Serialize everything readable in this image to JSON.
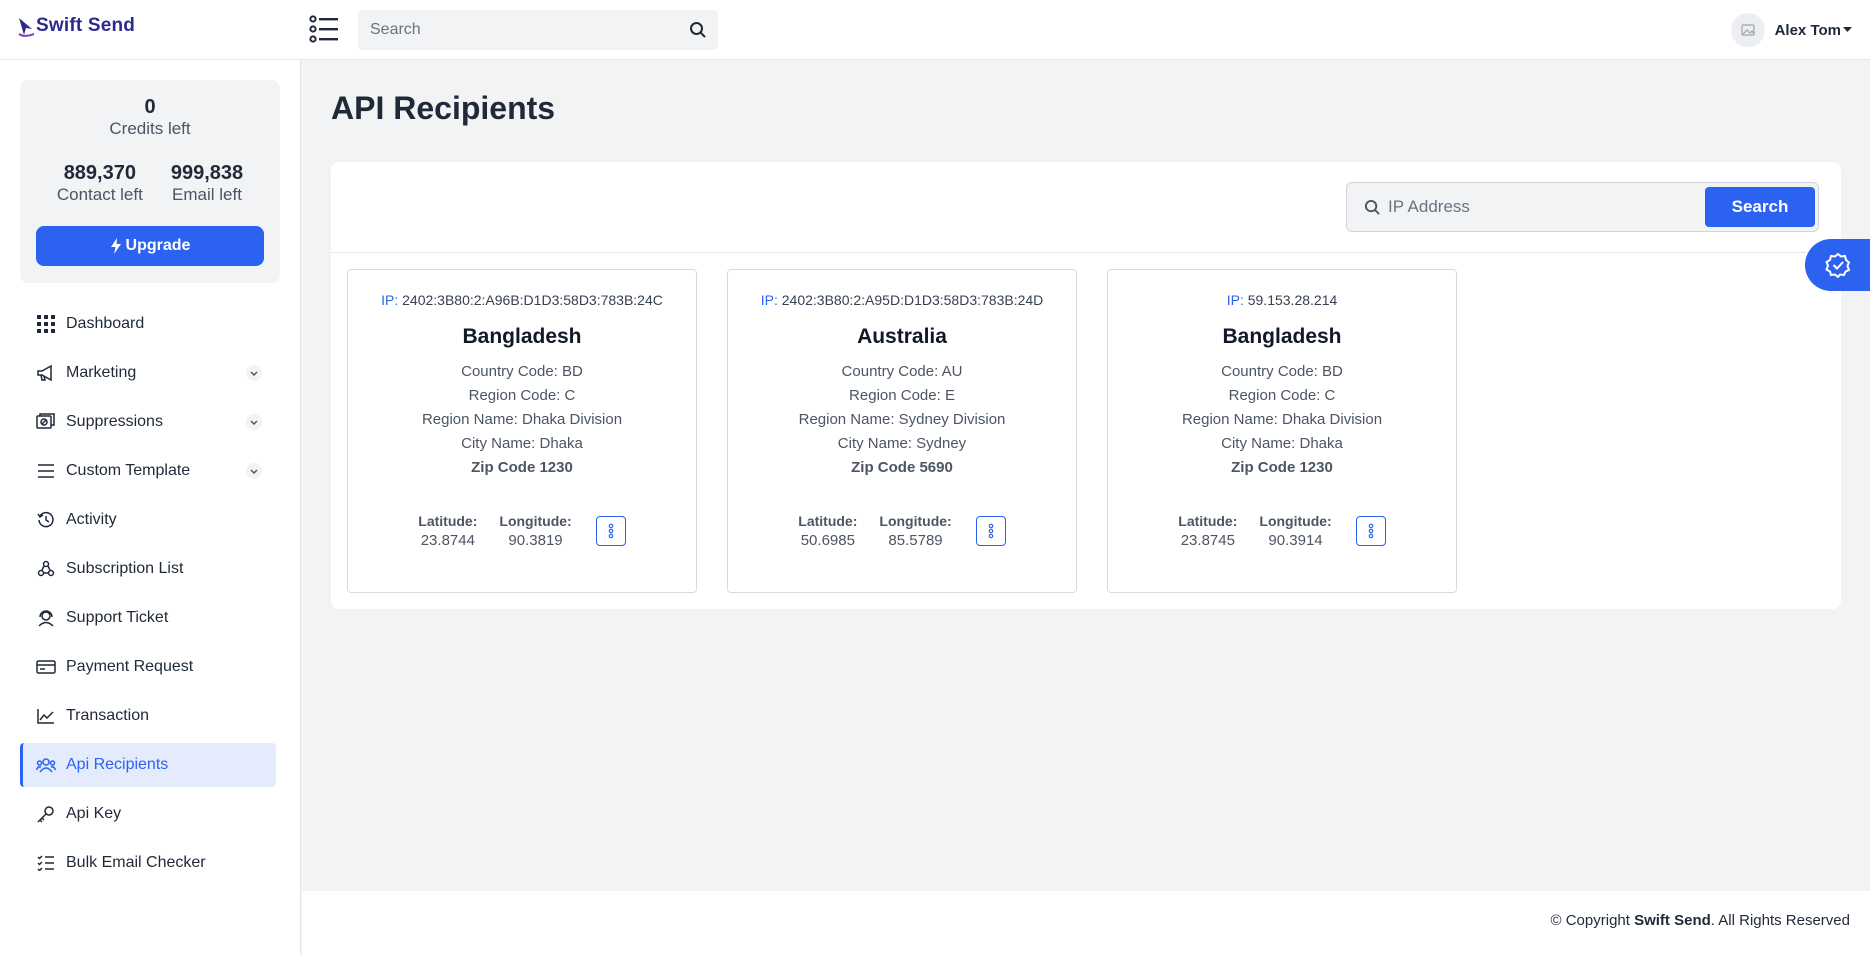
{
  "app": {
    "name": "Swift Send"
  },
  "header": {
    "search_placeholder": "Search",
    "user_name": "Alex Tom"
  },
  "credits": {
    "credits_value": "0",
    "credits_label": "Credits left",
    "contact_value": "889,370",
    "contact_label": "Contact left",
    "email_value": "999,838",
    "email_label": "Email left",
    "upgrade_label": "Upgrade"
  },
  "sidebar": {
    "items": [
      {
        "label": "Dashboard",
        "icon": "grid-icon"
      },
      {
        "label": "Marketing",
        "icon": "megaphone-icon",
        "expandable": true
      },
      {
        "label": "Suppressions",
        "icon": "suppression-icon",
        "expandable": true
      },
      {
        "label": "Custom Template",
        "icon": "list-icon",
        "expandable": true
      },
      {
        "label": "Activity",
        "icon": "history-icon"
      },
      {
        "label": "Subscription List",
        "icon": "subscription-icon"
      },
      {
        "label": "Support Ticket",
        "icon": "support-icon"
      },
      {
        "label": "Payment Request",
        "icon": "payment-icon"
      },
      {
        "label": "Transaction",
        "icon": "chart-icon"
      },
      {
        "label": "Api Recipients",
        "icon": "users-icon",
        "active": true
      },
      {
        "label": "Api Key",
        "icon": "key-icon"
      },
      {
        "label": "Bulk Email Checker",
        "icon": "checklist-icon"
      }
    ]
  },
  "main": {
    "title": "API Recipients",
    "ip_search_placeholder": "IP Address",
    "search_button": "Search",
    "ip_label": "IP:",
    "latitude_label": "Latitude:",
    "longitude_label": "Longitude:",
    "cards": [
      {
        "ip": "2402:3B80:2:A96B:D1D3:58D3:783B:24C",
        "country": "Bangladesh",
        "country_code": "Country Code: BD",
        "region_code": "Region Code: C",
        "region_name": "Region Name: Dhaka Division",
        "city_name": "City Name: Dhaka",
        "zip": "Zip Code 1230",
        "latitude": "23.8744",
        "longitude": "90.3819"
      },
      {
        "ip": "2402:3B80:2:A95D:D1D3:58D3:783B:24D",
        "country": "Australia",
        "country_code": "Country Code: AU",
        "region_code": "Region Code: E",
        "region_name": "Region Name: Sydney Division",
        "city_name": "City Name: Sydney",
        "zip": "Zip Code 5690",
        "latitude": "50.6985",
        "longitude": "85.5789"
      },
      {
        "ip": "59.153.28.214",
        "country": "Bangladesh",
        "country_code": "Country Code: BD",
        "region_code": "Region Code: C",
        "region_name": "Region Name: Dhaka Division",
        "city_name": "City Name: Dhaka",
        "zip": "Zip Code 1230",
        "latitude": "23.8745",
        "longitude": "90.3914"
      }
    ]
  },
  "footer": {
    "prefix": "© Copyright",
    "brand": "Swift Send",
    "suffix": ". All Rights Reserved"
  },
  "colors": {
    "accent": "#2b63f0",
    "brand": "#2c2a8f",
    "background": "#f2f3f5"
  }
}
